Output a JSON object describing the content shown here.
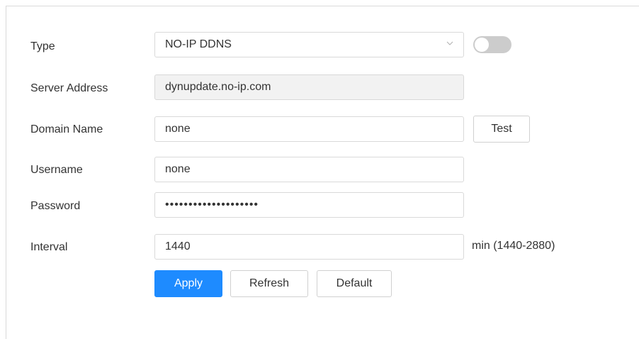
{
  "form": {
    "type": {
      "label": "Type",
      "value": "NO-IP DDNS",
      "enabled": false
    },
    "server_address": {
      "label": "Server Address",
      "value": "dynupdate.no-ip.com"
    },
    "domain_name": {
      "label": "Domain Name",
      "value": "none"
    },
    "username": {
      "label": "Username",
      "value": "none"
    },
    "password": {
      "label": "Password",
      "value": "••••••••••••••••••••"
    },
    "interval": {
      "label": "Interval",
      "value": "1440",
      "unit": "min (1440-2880)"
    }
  },
  "buttons": {
    "test": "Test",
    "apply": "Apply",
    "refresh": "Refresh",
    "default": "Default"
  },
  "colors": {
    "primary": "#1e8bff",
    "toggle_off": "#cccccc",
    "readonly_bg": "#f2f2f2"
  },
  "icons": {
    "select_caret": "chevron-down-icon"
  }
}
